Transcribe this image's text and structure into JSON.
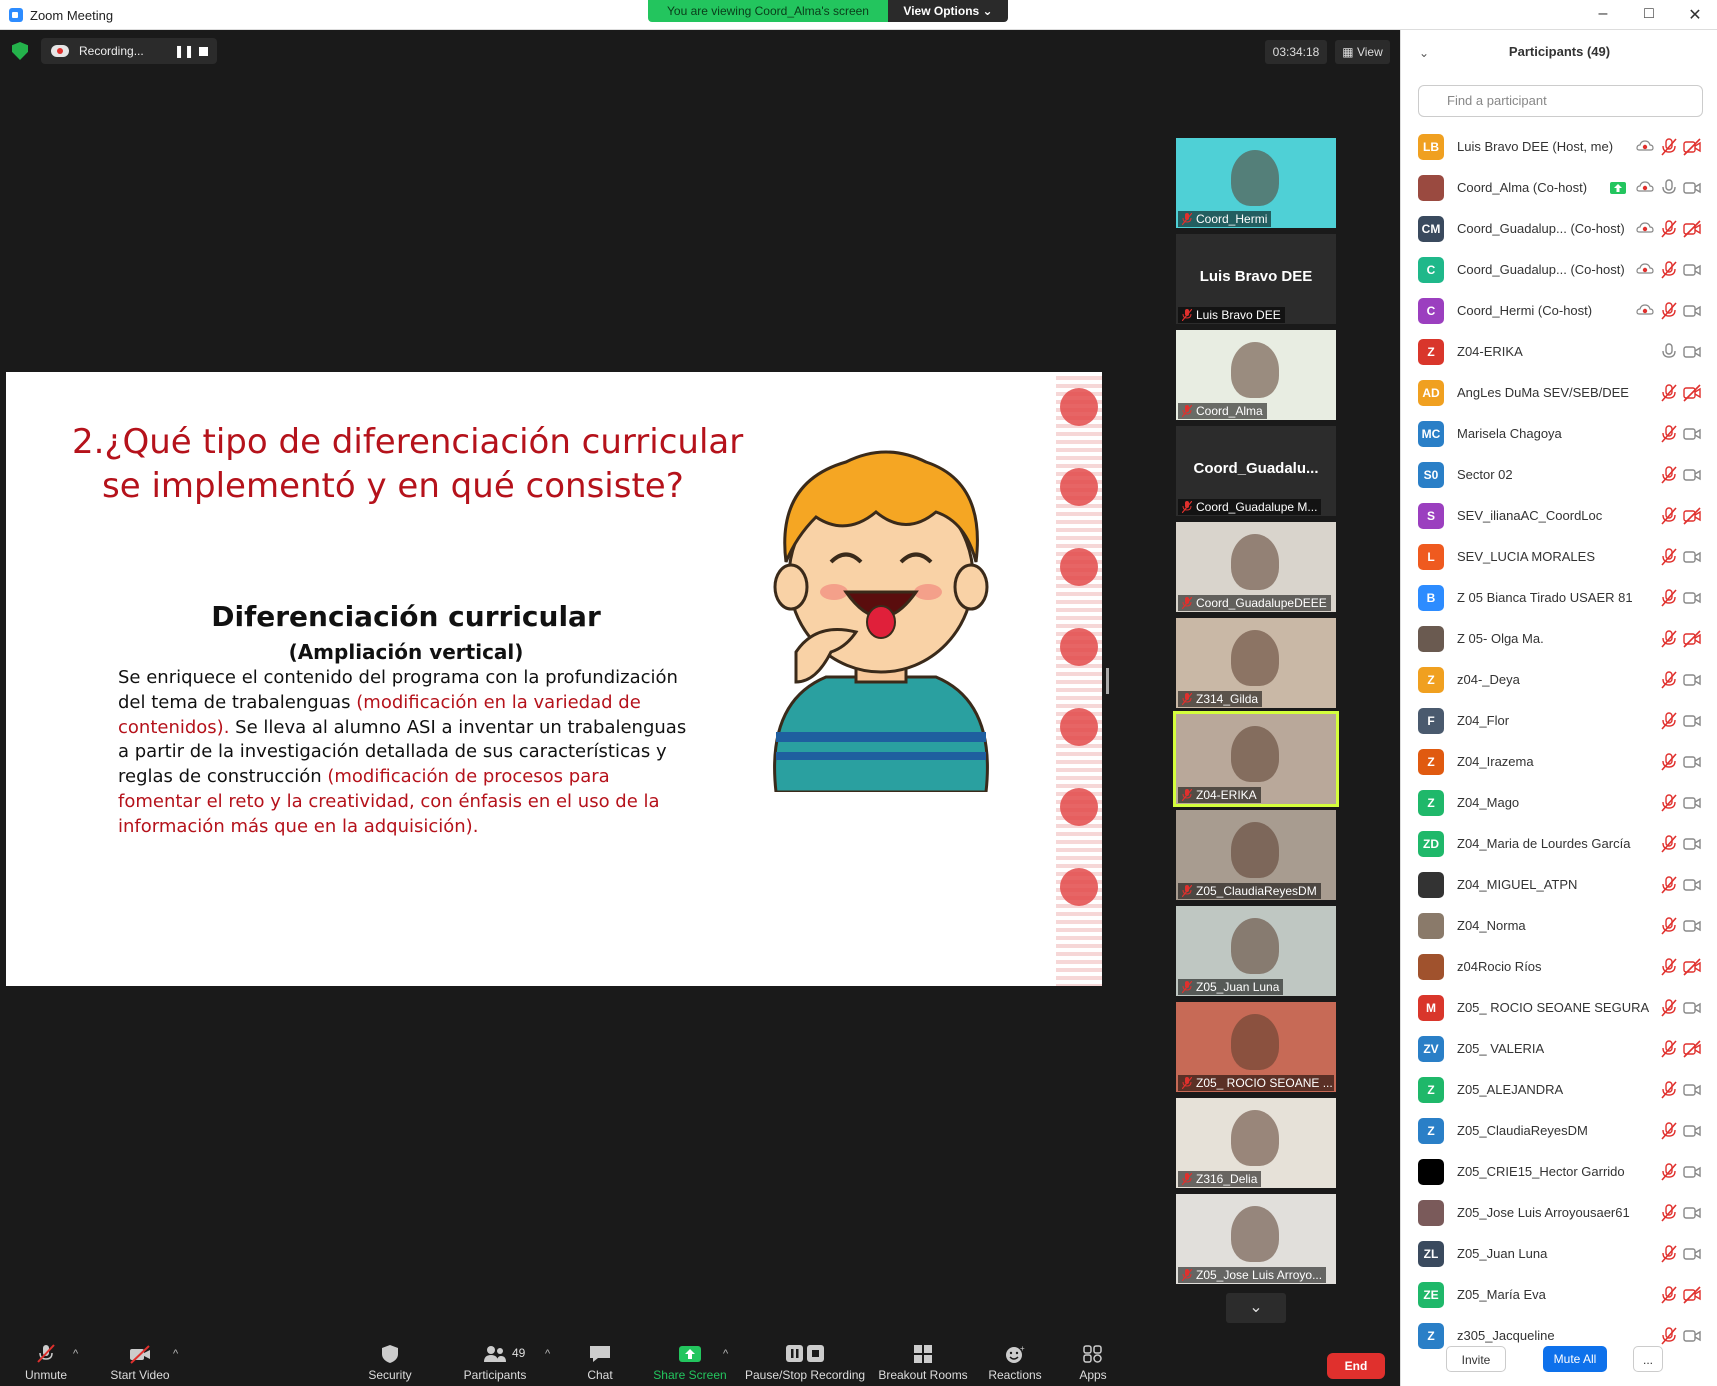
{
  "window": {
    "title": "Zoom Meeting",
    "viewing_banner": "You are viewing Coord_Alma's screen",
    "view_options": "View Options ⌄",
    "minimize": "–",
    "maximize": "□",
    "close": "✕"
  },
  "meeting": {
    "recording_label": "Recording...",
    "timer": "03:34:18",
    "view_label": "View"
  },
  "slide": {
    "title_line1": "2.¿Qué tipo de diferenciación curricular",
    "title_line2": "se implementó y en qué consiste?",
    "heading": "Diferenciación curricular",
    "subheading": "(Ampliación vertical)",
    "body_1": "Se enriquece el contenido del programa con la profundización del tema de trabalenguas ",
    "body_2_red": "(modificación en la variedad de contenidos).",
    "body_3": " Se lleva al alumno ASI a inventar un trabalenguas a partir de la investigación detallada de sus características y reglas de construcción ",
    "body_4_red": "(modificación de procesos para fomentar el reto y la creatividad, con énfasis en el uso de la información más que en la adquisición)."
  },
  "gallery": {
    "tiles": [
      {
        "name": "Coord_Hermi",
        "big": ""
      },
      {
        "name": "Luis Bravo DEE",
        "big": "Luis Bravo DEE"
      },
      {
        "name": "Coord_Alma",
        "big": ""
      },
      {
        "name": "Coord_Guadalupe M...",
        "big": "Coord_Guadalu..."
      },
      {
        "name": "Coord_GuadalupeDEEE",
        "big": ""
      },
      {
        "name": "Z314_Gilda",
        "big": ""
      },
      {
        "name": "Z04-ERIKA",
        "big": ""
      },
      {
        "name": "Z05_ClaudiaReyesDM",
        "big": ""
      },
      {
        "name": "Z05_Juan Luna",
        "big": ""
      },
      {
        "name": "Z05_ ROCIO SEOANE ...",
        "big": ""
      },
      {
        "name": "Z316_Delia",
        "big": ""
      },
      {
        "name": "Z05_Jose Luis Arroyo...",
        "big": ""
      }
    ],
    "more": "⌄"
  },
  "toolbar": {
    "unmute": "Unmute",
    "start_video": "Start Video",
    "security": "Security",
    "participants": "Participants",
    "participants_count": "49",
    "chat": "Chat",
    "share_screen": "Share Screen",
    "pause_recording": "Pause/Stop Recording",
    "breakout": "Breakout Rooms",
    "reactions": "Reactions",
    "apps": "Apps",
    "end": "End",
    "caret": "^"
  },
  "panel": {
    "title": "Participants (49)",
    "search_placeholder": "Find a participant",
    "invite": "Invite",
    "mute_all": "Mute All",
    "more": "...",
    "participants": [
      {
        "initials": "LB",
        "color": "#f0a020",
        "name": "Luis Bravo DEE (Host, me)"
      },
      {
        "initials": "",
        "color": "#9a4a40",
        "name": "Coord_Alma (Co-host)"
      },
      {
        "initials": "CM",
        "color": "#3a4a5e",
        "name": "Coord_Guadalup...  (Co-host)"
      },
      {
        "initials": "C",
        "color": "#1fb88a",
        "name": "Coord_Guadalup...  (Co-host)"
      },
      {
        "initials": "C",
        "color": "#9b3fbf",
        "name": "Coord_Hermi (Co-host)"
      },
      {
        "initials": "Z",
        "color": "#d9362b",
        "name": "Z04-ERIKA"
      },
      {
        "initials": "AD",
        "color": "#f0a020",
        "name": "AngLes DuMa SEV/SEB/DEE"
      },
      {
        "initials": "MC",
        "color": "#2a7fc7",
        "name": "Marisela Chagoya"
      },
      {
        "initials": "S0",
        "color": "#2a7fc7",
        "name": "Sector 02"
      },
      {
        "initials": "S",
        "color": "#9b3fbf",
        "name": "SEV_ilianaAC_CoordLoc"
      },
      {
        "initials": "L",
        "color": "#ef5a1f",
        "name": "SEV_LUCIA MORALES"
      },
      {
        "initials": "B",
        "color": "#2d8cff",
        "name": "Z 05 Bianca Tirado USAER 81"
      },
      {
        "initials": "",
        "color": "#6a5a50",
        "name": "Z 05- Olga Ma."
      },
      {
        "initials": "Z",
        "color": "#f0a020",
        "name": "z04-_Deya"
      },
      {
        "initials": "F",
        "color": "#4a5a6e",
        "name": "Z04_Flor"
      },
      {
        "initials": "Z",
        "color": "#e05a10",
        "name": "Z04_Irazema"
      },
      {
        "initials": "Z",
        "color": "#1fb86a",
        "name": "Z04_Mago"
      },
      {
        "initials": "ZD",
        "color": "#1fb86a",
        "name": "Z04_Maria de Lourdes García"
      },
      {
        "initials": "",
        "color": "#333333",
        "name": "Z04_MIGUEL_ATPN"
      },
      {
        "initials": "",
        "color": "#8a7a6a",
        "name": "Z04_Norma"
      },
      {
        "initials": "",
        "color": "#a0522d",
        "name": "z04Rocio Ríos"
      },
      {
        "initials": "M",
        "color": "#d9362b",
        "name": "Z05_ ROCIO SEOANE SEGURA"
      },
      {
        "initials": "ZV",
        "color": "#2a7fc7",
        "name": "Z05_ VALERIA"
      },
      {
        "initials": "Z",
        "color": "#1fb86a",
        "name": "Z05_ALEJANDRA"
      },
      {
        "initials": "Z",
        "color": "#2a7fc7",
        "name": "Z05_ClaudiaReyesDM"
      },
      {
        "initials": "",
        "color": "#000000",
        "name": "Z05_CRIE15_Hector Garrido"
      },
      {
        "initials": "",
        "color": "#7a5a5a",
        "name": "Z05_Jose Luis Arroyousaer61"
      },
      {
        "initials": "ZL",
        "color": "#3a4a5e",
        "name": "Z05_Juan Luna"
      },
      {
        "initials": "ZE",
        "color": "#1fb86a",
        "name": "Z05_María Eva"
      },
      {
        "initials": "Z",
        "color": "#2a7fc7",
        "name": "z305_Jacqueline"
      }
    ]
  }
}
